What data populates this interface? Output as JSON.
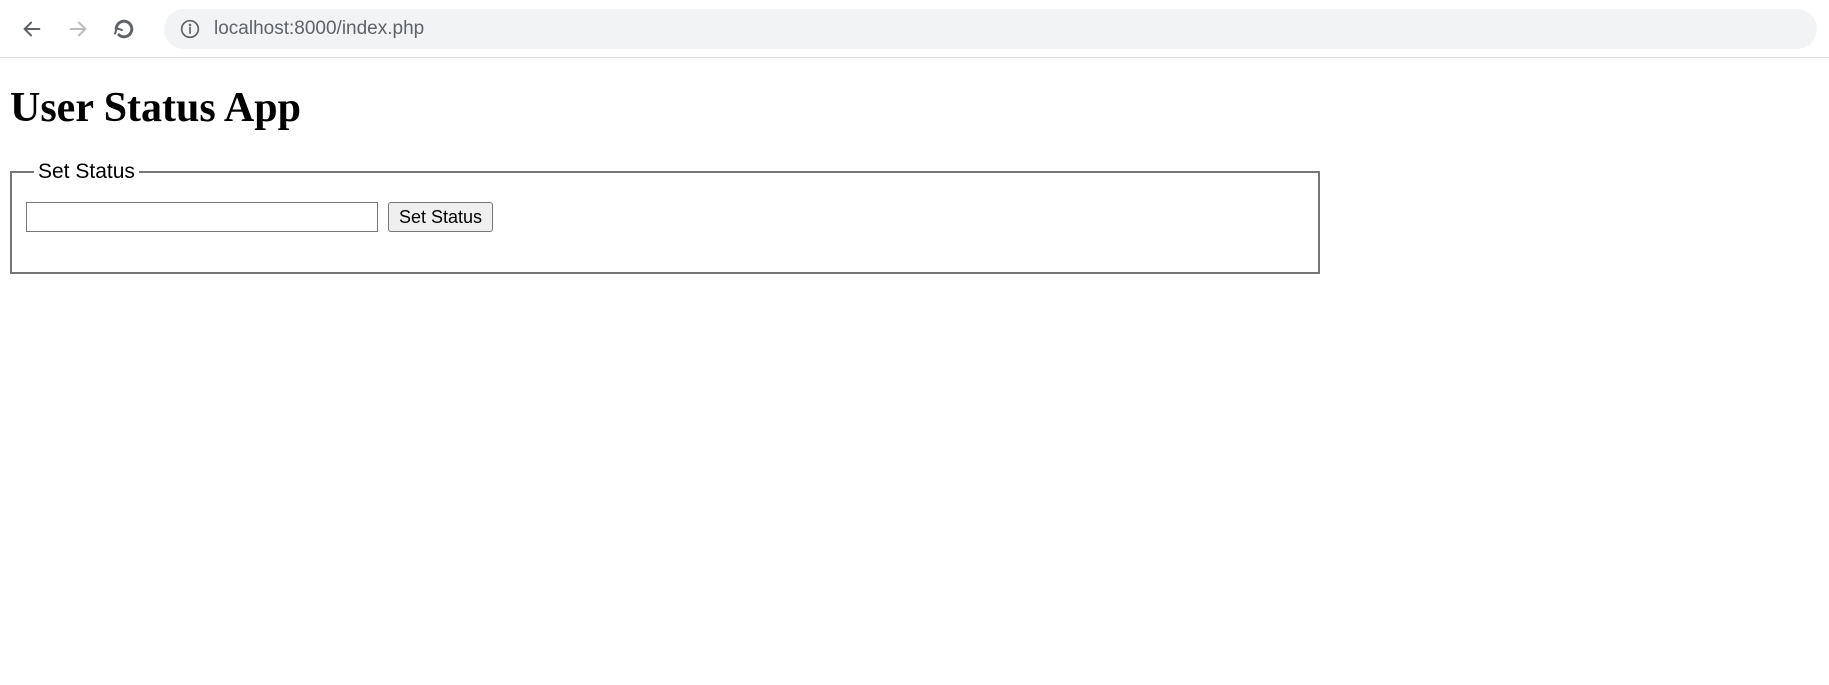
{
  "browser": {
    "url_host": "localhost:",
    "url_port_path": "8000/index.php"
  },
  "page": {
    "title": "User Status App",
    "fieldset": {
      "legend": "Set Status",
      "input_value": "",
      "button_label": "Set Status"
    }
  }
}
